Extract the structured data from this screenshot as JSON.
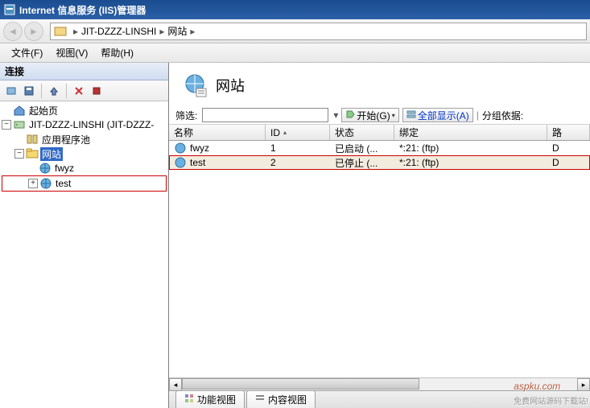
{
  "window": {
    "title": "Internet 信息服务 (IIS)管理器"
  },
  "breadcrumb": {
    "server": "JIT-DZZZ-LINSHI",
    "node": "网站"
  },
  "menu": {
    "file": "文件(F)",
    "view": "视图(V)",
    "help": "帮助(H)"
  },
  "left": {
    "header": "连接",
    "start_page": "起始页",
    "server": "JIT-DZZZ-LINSHI (JIT-DZZZ-",
    "app_pools": "应用程序池",
    "sites": "网站",
    "site_fwyz": "fwyz",
    "site_test": "test"
  },
  "content": {
    "title": "网站",
    "filter_label": "筛选:",
    "start_btn": "开始(G)",
    "show_all": "全部显示(A)",
    "group_by": "分组依据:"
  },
  "columns": {
    "name": "名称",
    "id": "ID",
    "status": "状态",
    "binding": "绑定",
    "last": "路"
  },
  "rows": [
    {
      "name": "fwyz",
      "id": "1",
      "status": "已启动 (...",
      "binding": "*:21: (ftp)",
      "last": "D"
    },
    {
      "name": "test",
      "id": "2",
      "status": "已停止 (...",
      "binding": "*:21: (ftp)",
      "last": "D"
    }
  ],
  "tabs": {
    "features": "功能视图",
    "content": "内容视图"
  },
  "watermark": {
    "brand": "aspku",
    "tld": ".com",
    "sub": "免费网站源码下载站!"
  }
}
